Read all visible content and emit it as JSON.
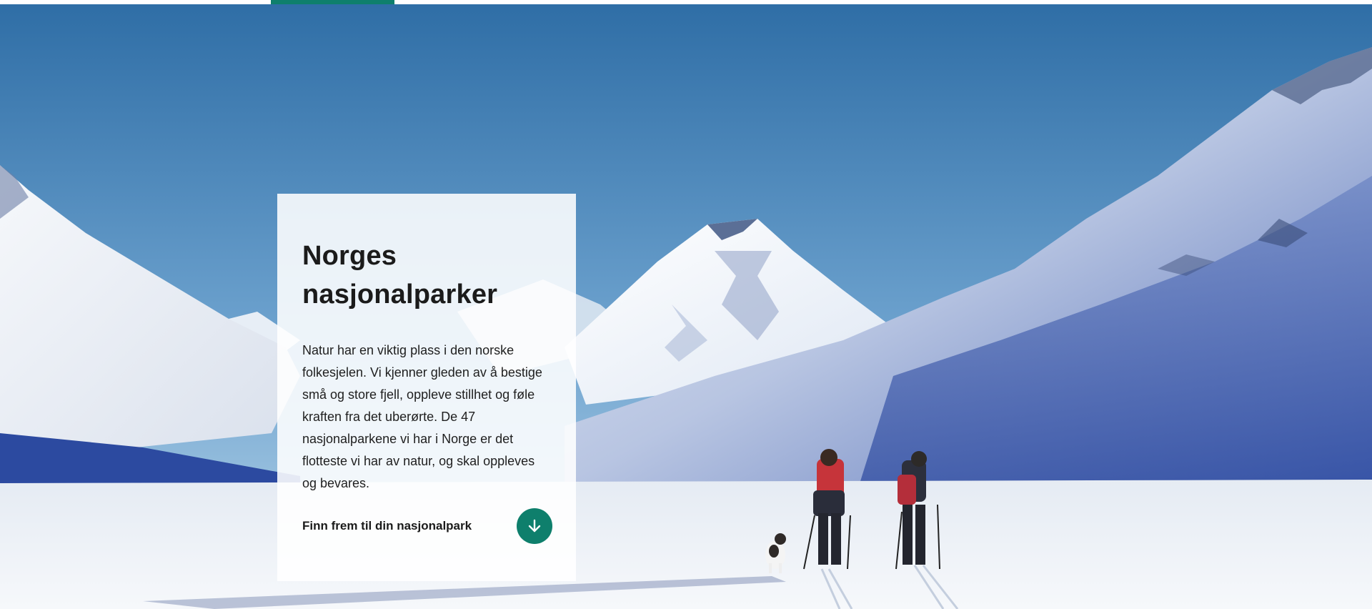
{
  "theme": {
    "accent": "#0e7f6c",
    "sky_top": "#2d6fa8",
    "sky_bottom": "#a9cde6",
    "snow": "#f3f6fa",
    "mountain_shadow": "#2c4fa3"
  },
  "hero": {
    "image": "winter-mountain-hikers"
  },
  "card": {
    "title": "Norges nasjonalparker",
    "body": "Natur har en viktig plass i den norske folkesjelen. Vi kjenner gleden av å bestige små og store fjell, oppleve stillhet og føle kraften fra det uberørte. De 47 nasjonalparkene vi har i Norge er det flotteste vi har av natur, og skal oppleves og bevares.",
    "link_label": "Finn frem til din nasjonalpark",
    "link_icon": "arrow-down-icon"
  }
}
